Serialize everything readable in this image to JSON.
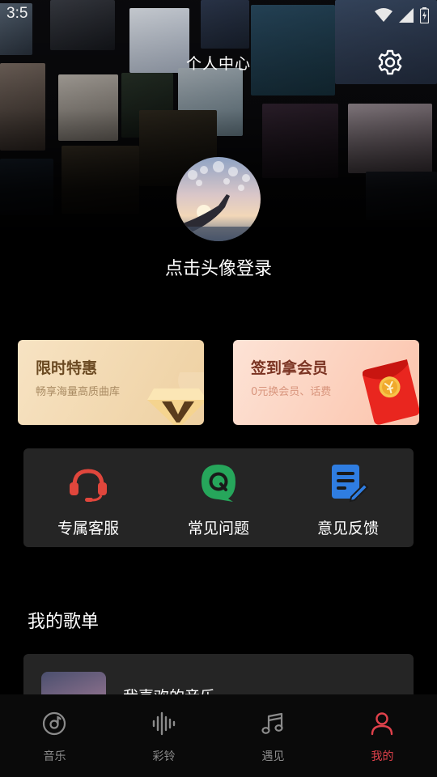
{
  "status_bar": {
    "time": "3:5"
  },
  "header": {
    "title": "个人中心",
    "settings_icon": "gear-icon"
  },
  "profile": {
    "login_prompt": "点击头像登录",
    "avatar_icon": "avatar"
  },
  "promos": [
    {
      "title": "限时特惠",
      "subtitle": "畅享海量高质曲库",
      "decoration": "gold-v-diamond-icon"
    },
    {
      "title": "签到拿会员",
      "subtitle": "0元换会员、话费",
      "decoration": "red-envelope-icon"
    }
  ],
  "services": [
    {
      "label": "专属客服",
      "icon": "headset-icon",
      "color": "#e0463c"
    },
    {
      "label": "常见问题",
      "icon": "faq-q-icon",
      "color": "#26a65b"
    },
    {
      "label": "意见反馈",
      "icon": "feedback-edit-icon",
      "color": "#2f7de1"
    }
  ],
  "my_playlists": {
    "title": "我的歌单",
    "items": [
      {
        "name": "我喜欢的音乐"
      }
    ]
  },
  "bottom_nav": [
    {
      "label": "音乐",
      "icon": "music-disc-icon",
      "active": false
    },
    {
      "label": "彩铃",
      "icon": "sound-wave-icon",
      "active": false
    },
    {
      "label": "遇见",
      "icon": "music-note-icon",
      "active": false
    },
    {
      "label": "我的",
      "icon": "person-icon",
      "active": true
    }
  ],
  "colors": {
    "background": "#000000",
    "card": "#252525",
    "accent": "#e0414b",
    "nav_inactive": "#8b8b8b"
  }
}
